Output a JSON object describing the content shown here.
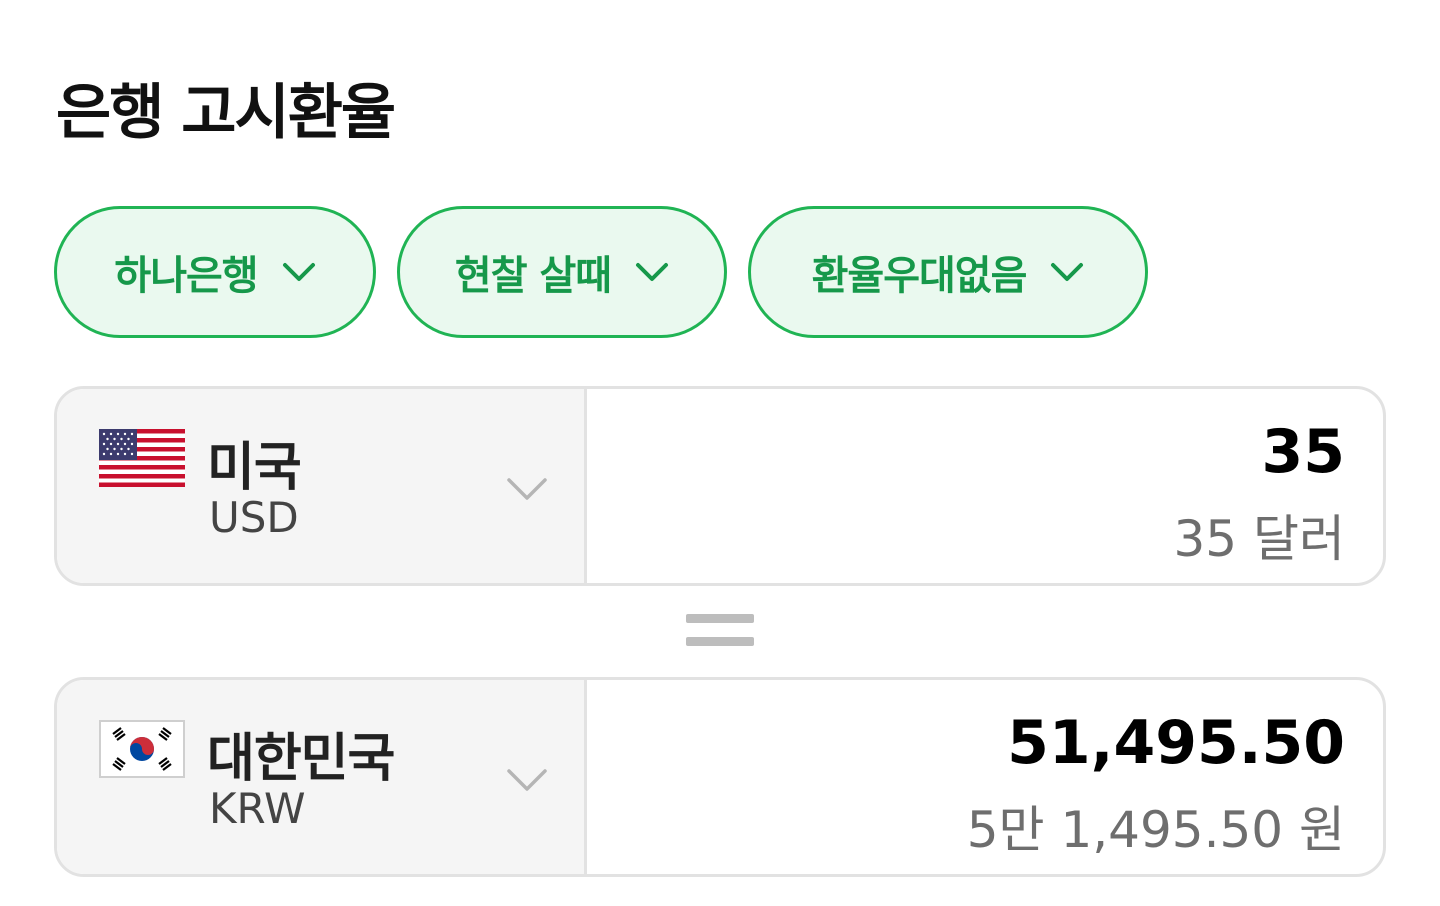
{
  "header": {
    "title": "은행 고시환율"
  },
  "filters": [
    {
      "label": "하나은행",
      "icon": "chevron-down-icon"
    },
    {
      "label": "현찰 살때",
      "icon": "chevron-down-icon"
    },
    {
      "label": "환율우대없음",
      "icon": "chevron-down-icon"
    }
  ],
  "from": {
    "country": "미국",
    "currency_code": "USD",
    "flag": "us-flag-icon",
    "amount": "35",
    "amount_text": "35 달러"
  },
  "equals_icon": "equals-icon",
  "to": {
    "country": "대한민국",
    "currency_code": "KRW",
    "flag": "kr-flag-icon",
    "amount": "51,495.50",
    "amount_text": "5만 1,495.50 원"
  },
  "colors": {
    "accent": "#20b454",
    "accent_text": "#16984a",
    "chip_bg": "#eaf9ef",
    "card_border": "#e2e2e2",
    "selector_bg": "#f5f5f5",
    "secondary_text": "#6e6e6e"
  }
}
